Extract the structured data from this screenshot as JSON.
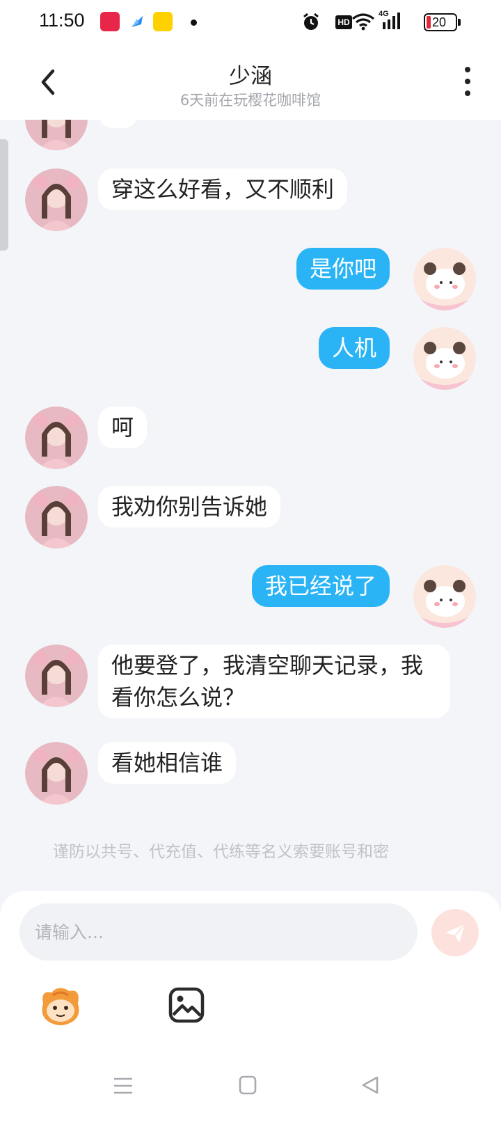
{
  "status_bar": {
    "time": "11:50",
    "network": "4G",
    "hd": "HD",
    "battery": "20"
  },
  "header": {
    "title": "少涵",
    "subtitle": "6天前在玩樱花咖啡馆"
  },
  "messages": [
    {
      "side": "them",
      "text": "穿这么好看，又不顺利"
    },
    {
      "side": "me",
      "text": "是你吧"
    },
    {
      "side": "me",
      "text": "人机"
    },
    {
      "side": "them",
      "text": "呵"
    },
    {
      "side": "them",
      "text": "我劝你别告诉她"
    },
    {
      "side": "me",
      "text": "我已经说了"
    },
    {
      "side": "them",
      "text": "他要登了，我清空聊天记录，我看你怎么说？"
    },
    {
      "side": "them",
      "text": "看她相信谁"
    }
  ],
  "notice": "谨防以共号、代充值、代练等名义索要账号和密",
  "input": {
    "placeholder": "请输入..."
  },
  "colors": {
    "my_bubble": "#2bb4f5",
    "their_bubble": "#ffffff",
    "background": "#f4f5f9",
    "send_button": "#fde1dc"
  }
}
